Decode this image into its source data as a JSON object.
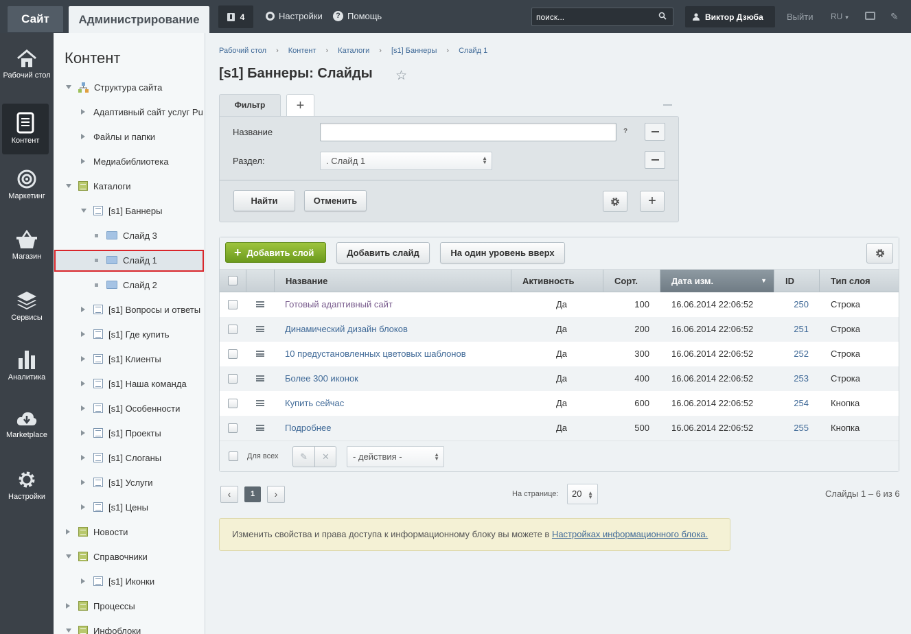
{
  "topbar": {
    "site_tab": "Сайт",
    "admin_tab": "Администрирование",
    "notifications_count": "4",
    "settings": "Настройки",
    "help": "Помощь",
    "help_icon": "?",
    "search_placeholder": "поиск...",
    "user": "Виктор Дзюба",
    "logout": "Выйти",
    "lang": "RU",
    "icons": [
      "notification-icon",
      "gear-icon",
      "help-icon",
      "search-icon",
      "user-icon",
      "keyboard-icon",
      "pin-icon"
    ]
  },
  "leftnav": [
    {
      "label": "Рабочий стол",
      "icon": "home-icon"
    },
    {
      "label": "Контент",
      "icon": "document-icon",
      "active": true
    },
    {
      "label": "Маркетинг",
      "icon": "target-icon"
    },
    {
      "label": "Магазин",
      "icon": "basket-icon"
    },
    {
      "label": "Сервисы",
      "icon": "layers-icon"
    },
    {
      "label": "Аналитика",
      "icon": "bar-chart-icon"
    },
    {
      "label": "Marketplace",
      "icon": "cloud-download-icon"
    },
    {
      "label": "Настройки",
      "icon": "gear-icon"
    }
  ],
  "tree": {
    "title": "Контент",
    "nodes": [
      {
        "label": "Структура сайта",
        "arrow": "down",
        "icon": "structure"
      },
      {
        "label": "Адаптивный сайт услуг Pu",
        "arrow": "right"
      },
      {
        "label": "Файлы и папки",
        "arrow": "right"
      },
      {
        "label": "Медиабиблиотека",
        "arrow": "right"
      },
      {
        "label": "Каталоги",
        "arrow": "down",
        "icon": "book"
      },
      {
        "label": "[s1] Баннеры",
        "arrow": "down",
        "icon": "list"
      },
      {
        "label": "Слайд 3",
        "arrow": "dot",
        "icon": "folder"
      },
      {
        "label": "Слайд 1",
        "arrow": "dot",
        "icon": "folder",
        "selected": true
      },
      {
        "label": "Слайд 2",
        "arrow": "dot",
        "icon": "folder"
      },
      {
        "label": "[s1] Вопросы и ответы",
        "arrow": "right",
        "icon": "list"
      },
      {
        "label": "[s1] Где купить",
        "arrow": "right",
        "icon": "list"
      },
      {
        "label": "[s1] Клиенты",
        "arrow": "right",
        "icon": "list"
      },
      {
        "label": "[s1] Наша команда",
        "arrow": "right",
        "icon": "list"
      },
      {
        "label": "[s1] Особенности",
        "arrow": "right",
        "icon": "list"
      },
      {
        "label": "[s1] Проекты",
        "arrow": "right",
        "icon": "list"
      },
      {
        "label": "[s1] Слоганы",
        "arrow": "right",
        "icon": "list"
      },
      {
        "label": "[s1] Услуги",
        "arrow": "right",
        "icon": "list"
      },
      {
        "label": "[s1] Цены",
        "arrow": "right",
        "icon": "list"
      },
      {
        "label": "Новости",
        "arrow": "right",
        "icon": "book"
      },
      {
        "label": "Справочники",
        "arrow": "down",
        "icon": "book"
      },
      {
        "label": "[s1] Иконки",
        "arrow": "right",
        "icon": "list"
      },
      {
        "label": "Процессы",
        "arrow": "right",
        "icon": "book"
      },
      {
        "label": "Инфоблоки",
        "arrow": "down",
        "icon": "book"
      }
    ]
  },
  "breadcrumb": [
    "Рабочий стол",
    "Контент",
    "Каталоги",
    "[s1] Баннеры",
    "Слайд 1"
  ],
  "page_title": "[s1] Баннеры: Слайды",
  "filter": {
    "tab": "Фильтр",
    "add_tab": "+",
    "name_label": "Название",
    "name_value": "",
    "name_help": "?",
    "section_label": "Раздел:",
    "section_value": ". Слайд 1",
    "find": "Найти",
    "cancel": "Отменить",
    "add": "+"
  },
  "grid": {
    "add_layer": "Добавить слой",
    "add_slide": "Добавить слайд",
    "level_up": "На один уровень вверх",
    "columns": [
      "Название",
      "Активность",
      "Сорт.",
      "Дата изм.",
      "ID",
      "Тип слоя"
    ],
    "rows": [
      {
        "name": "Готовый адаптивный сайт",
        "active": "Да",
        "sort": "100",
        "date": "16.06.2014 22:06:52",
        "id": "250",
        "type": "Строка"
      },
      {
        "name": "Динамический дизайн блоков",
        "active": "Да",
        "sort": "200",
        "date": "16.06.2014 22:06:52",
        "id": "251",
        "type": "Строка"
      },
      {
        "name": "10 предустановленных цветовых шаблонов",
        "active": "Да",
        "sort": "300",
        "date": "16.06.2014 22:06:52",
        "id": "252",
        "type": "Строка"
      },
      {
        "name": "Более 300 иконок",
        "active": "Да",
        "sort": "400",
        "date": "16.06.2014 22:06:52",
        "id": "253",
        "type": "Строка"
      },
      {
        "name": "Купить сейчас",
        "active": "Да",
        "sort": "600",
        "date": "16.06.2014 22:06:52",
        "id": "254",
        "type": "Кнопка"
      },
      {
        "name": "Подробнее",
        "active": "Да",
        "sort": "500",
        "date": "16.06.2014 22:06:52",
        "id": "255",
        "type": "Кнопка"
      }
    ],
    "for_all": "Для всех",
    "actions": "- действия -"
  },
  "pager": {
    "current": "1",
    "per_page_label": "На странице:",
    "per_page": "20",
    "total": "Слайды 1 – 6 из 6"
  },
  "notice": {
    "text": "Изменить свойства и права доступа к информационному блоку вы можете в ",
    "link": "Настройках информационного блока."
  }
}
